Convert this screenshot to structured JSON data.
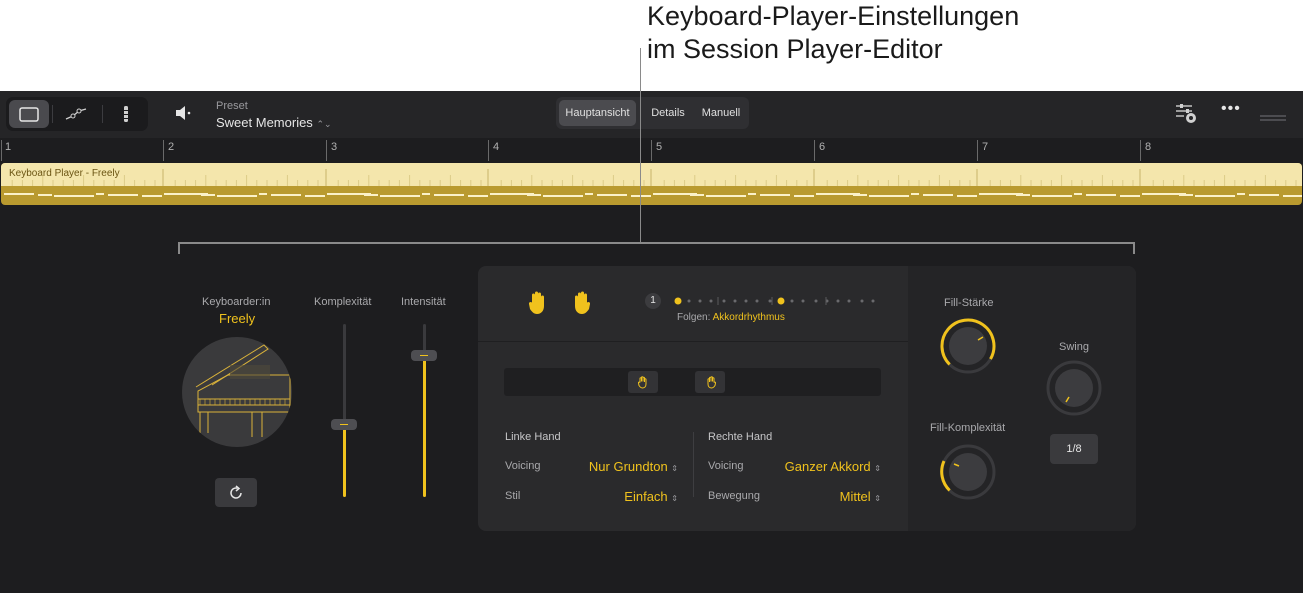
{
  "callout": {
    "line1": "Keyboard-Player-Einstellungen",
    "line2": "im Session Player-Editor"
  },
  "toolbar": {
    "preset_label": "Preset",
    "preset_value": "Sweet Memories",
    "tabs": [
      {
        "label": "Hauptansicht",
        "active": true
      },
      {
        "label": "Details",
        "active": false
      },
      {
        "label": "Manuell",
        "active": false
      }
    ]
  },
  "ruler": {
    "bars": [
      "1",
      "2",
      "3",
      "4",
      "5",
      "6",
      "7",
      "8"
    ]
  },
  "region": {
    "name": "Keyboard Player - Freely"
  },
  "player": {
    "label": "Keyboarder:in",
    "name": "Freely"
  },
  "sliders": {
    "complexity_label": "Komplexität",
    "complexity_value": 0.42,
    "intensity_label": "Intensität",
    "intensity_value": 0.82
  },
  "rhythm": {
    "step_number": "1",
    "follow_label": "Folgen:",
    "follow_value": "Akkordrhythmus"
  },
  "left_hand": {
    "title": "Linke Hand",
    "voicing_label": "Voicing",
    "voicing_value": "Nur Grundton",
    "style_label": "Stil",
    "style_value": "Einfach"
  },
  "right_hand": {
    "title": "Rechte Hand",
    "voicing_label": "Voicing",
    "voicing_value": "Ganzer Akkord",
    "movement_label": "Bewegung",
    "movement_value": "Mittel"
  },
  "fills": {
    "strength_label": "Fill-Stärke",
    "complexity_label": "Fill-Komplexität",
    "swing_label": "Swing",
    "swing_value": "1/8"
  },
  "colors": {
    "accent": "#f0c21d",
    "background": "#1d1d1f",
    "region": "#f4e6ac"
  }
}
